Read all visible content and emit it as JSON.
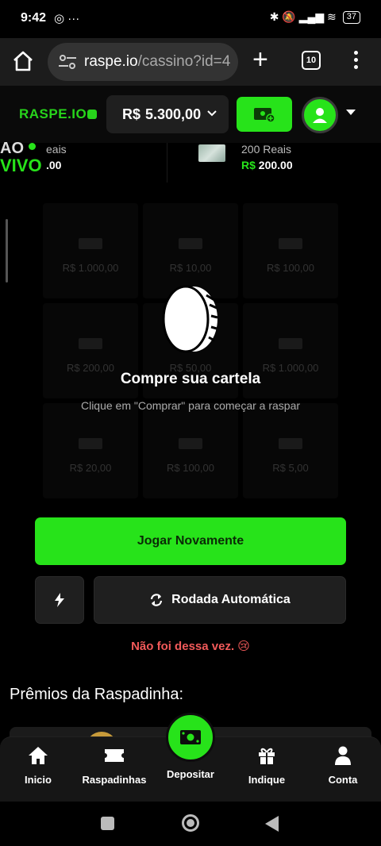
{
  "status_bar": {
    "time": "9:42",
    "left_icons": "◎ ···",
    "right_icons": "✱ 🔕 ▂▄▆ ≋",
    "battery": "37"
  },
  "browser": {
    "url_domain": "raspe.io",
    "url_path": "/cassino?id=4",
    "tabs_count": "10"
  },
  "header": {
    "logo": "RASPE.IO",
    "currency": "R$",
    "balance": "5.300,00"
  },
  "ticker": {
    "live_line1": "AO",
    "live_line2": "VIVO",
    "item1_name": "eais",
    "item1_value": ".00",
    "item2_name": "200 Reais",
    "item2_currency": "R$",
    "item2_value": "200.00"
  },
  "grid": [
    "R$ 1.000,00",
    "R$ 10,00",
    "R$ 100,00",
    "R$ 200,00",
    "R$ 50,00",
    "R$ 1.000,00",
    "R$ 20,00",
    "R$ 100,00",
    "R$ 5,00"
  ],
  "overlay": {
    "title": "Compre sua cartela",
    "subtitle": "Clique em \"Comprar\" para começar a raspar"
  },
  "actions": {
    "play_again": "Jogar Novamente",
    "auto_round": "Rodada Automática"
  },
  "result_text": "Não foi dessa vez. 😢",
  "prizes_title": "Prêmios da Raspadinha:",
  "bottom_nav": {
    "home": "Inicio",
    "scratch": "Raspadinhas",
    "deposit": "Depositar",
    "refer": "Indique",
    "account": "Conta"
  },
  "colors": {
    "accent": "#27e31a",
    "error": "#f25a5a",
    "background": "#000000"
  }
}
